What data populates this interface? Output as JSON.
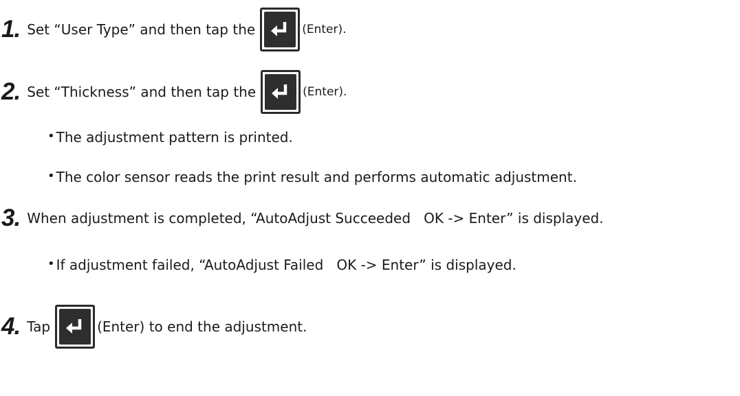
{
  "steps": [
    {
      "number": "1.",
      "before": "Set “User Type” and then tap the",
      "after": "(Enter).",
      "icon": "enter-key-icon"
    },
    {
      "number": "2.",
      "before": "Set “Thickness” and then tap the",
      "after": "(Enter).",
      "icon": "enter-key-icon"
    },
    {
      "number": "3.",
      "text": "When adjustment is completed, “AutoAdjust Succeeded   OK -> Enter” is displayed."
    },
    {
      "number": "4.",
      "before": "Tap",
      "after": "(Enter) to end the adjustment.",
      "icon": "enter-key-icon"
    }
  ],
  "bullets": {
    "step2": [
      "The adjustment pattern is printed.",
      "The color sensor reads the print result and performs automatic adjustment."
    ],
    "step3": [
      "If adjustment failed, “AutoAdjust Failed   OK -> Enter” is displayed."
    ]
  },
  "bullet_symbol": "•",
  "colors": {
    "text": "#1a1a1a",
    "key_fill": "#2e2e2e",
    "key_border": "#2a2a2a",
    "key_glyph": "#ffffff"
  }
}
